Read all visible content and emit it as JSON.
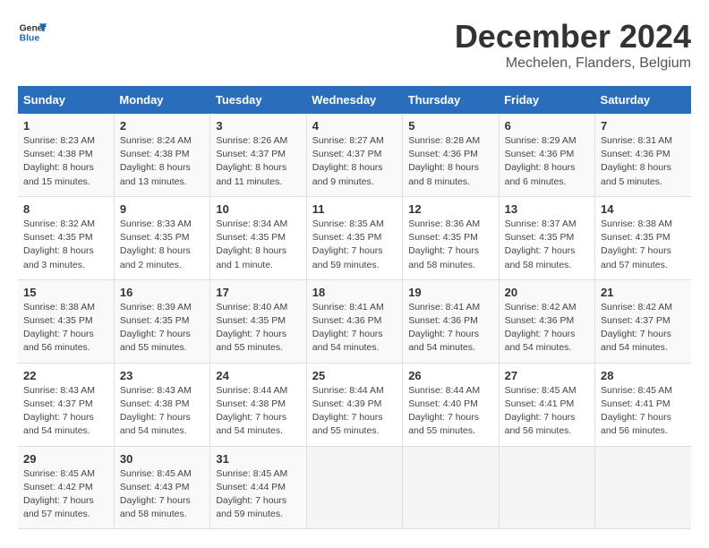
{
  "header": {
    "logo_line1": "General",
    "logo_line2": "Blue",
    "month_year": "December 2024",
    "location": "Mechelen, Flanders, Belgium"
  },
  "days_of_week": [
    "Sunday",
    "Monday",
    "Tuesday",
    "Wednesday",
    "Thursday",
    "Friday",
    "Saturday"
  ],
  "weeks": [
    [
      {
        "day": "1",
        "info": "Sunrise: 8:23 AM\nSunset: 4:38 PM\nDaylight: 8 hours\nand 15 minutes."
      },
      {
        "day": "2",
        "info": "Sunrise: 8:24 AM\nSunset: 4:38 PM\nDaylight: 8 hours\nand 13 minutes."
      },
      {
        "day": "3",
        "info": "Sunrise: 8:26 AM\nSunset: 4:37 PM\nDaylight: 8 hours\nand 11 minutes."
      },
      {
        "day": "4",
        "info": "Sunrise: 8:27 AM\nSunset: 4:37 PM\nDaylight: 8 hours\nand 9 minutes."
      },
      {
        "day": "5",
        "info": "Sunrise: 8:28 AM\nSunset: 4:36 PM\nDaylight: 8 hours\nand 8 minutes."
      },
      {
        "day": "6",
        "info": "Sunrise: 8:29 AM\nSunset: 4:36 PM\nDaylight: 8 hours\nand 6 minutes."
      },
      {
        "day": "7",
        "info": "Sunrise: 8:31 AM\nSunset: 4:36 PM\nDaylight: 8 hours\nand 5 minutes."
      }
    ],
    [
      {
        "day": "8",
        "info": "Sunrise: 8:32 AM\nSunset: 4:35 PM\nDaylight: 8 hours\nand 3 minutes."
      },
      {
        "day": "9",
        "info": "Sunrise: 8:33 AM\nSunset: 4:35 PM\nDaylight: 8 hours\nand 2 minutes."
      },
      {
        "day": "10",
        "info": "Sunrise: 8:34 AM\nSunset: 4:35 PM\nDaylight: 8 hours\nand 1 minute."
      },
      {
        "day": "11",
        "info": "Sunrise: 8:35 AM\nSunset: 4:35 PM\nDaylight: 7 hours\nand 59 minutes."
      },
      {
        "day": "12",
        "info": "Sunrise: 8:36 AM\nSunset: 4:35 PM\nDaylight: 7 hours\nand 58 minutes."
      },
      {
        "day": "13",
        "info": "Sunrise: 8:37 AM\nSunset: 4:35 PM\nDaylight: 7 hours\nand 58 minutes."
      },
      {
        "day": "14",
        "info": "Sunrise: 8:38 AM\nSunset: 4:35 PM\nDaylight: 7 hours\nand 57 minutes."
      }
    ],
    [
      {
        "day": "15",
        "info": "Sunrise: 8:38 AM\nSunset: 4:35 PM\nDaylight: 7 hours\nand 56 minutes."
      },
      {
        "day": "16",
        "info": "Sunrise: 8:39 AM\nSunset: 4:35 PM\nDaylight: 7 hours\nand 55 minutes."
      },
      {
        "day": "17",
        "info": "Sunrise: 8:40 AM\nSunset: 4:35 PM\nDaylight: 7 hours\nand 55 minutes."
      },
      {
        "day": "18",
        "info": "Sunrise: 8:41 AM\nSunset: 4:36 PM\nDaylight: 7 hours\nand 54 minutes."
      },
      {
        "day": "19",
        "info": "Sunrise: 8:41 AM\nSunset: 4:36 PM\nDaylight: 7 hours\nand 54 minutes."
      },
      {
        "day": "20",
        "info": "Sunrise: 8:42 AM\nSunset: 4:36 PM\nDaylight: 7 hours\nand 54 minutes."
      },
      {
        "day": "21",
        "info": "Sunrise: 8:42 AM\nSunset: 4:37 PM\nDaylight: 7 hours\nand 54 minutes."
      }
    ],
    [
      {
        "day": "22",
        "info": "Sunrise: 8:43 AM\nSunset: 4:37 PM\nDaylight: 7 hours\nand 54 minutes."
      },
      {
        "day": "23",
        "info": "Sunrise: 8:43 AM\nSunset: 4:38 PM\nDaylight: 7 hours\nand 54 minutes."
      },
      {
        "day": "24",
        "info": "Sunrise: 8:44 AM\nSunset: 4:38 PM\nDaylight: 7 hours\nand 54 minutes."
      },
      {
        "day": "25",
        "info": "Sunrise: 8:44 AM\nSunset: 4:39 PM\nDaylight: 7 hours\nand 55 minutes."
      },
      {
        "day": "26",
        "info": "Sunrise: 8:44 AM\nSunset: 4:40 PM\nDaylight: 7 hours\nand 55 minutes."
      },
      {
        "day": "27",
        "info": "Sunrise: 8:45 AM\nSunset: 4:41 PM\nDaylight: 7 hours\nand 56 minutes."
      },
      {
        "day": "28",
        "info": "Sunrise: 8:45 AM\nSunset: 4:41 PM\nDaylight: 7 hours\nand 56 minutes."
      }
    ],
    [
      {
        "day": "29",
        "info": "Sunrise: 8:45 AM\nSunset: 4:42 PM\nDaylight: 7 hours\nand 57 minutes."
      },
      {
        "day": "30",
        "info": "Sunrise: 8:45 AM\nSunset: 4:43 PM\nDaylight: 7 hours\nand 58 minutes."
      },
      {
        "day": "31",
        "info": "Sunrise: 8:45 AM\nSunset: 4:44 PM\nDaylight: 7 hours\nand 59 minutes."
      },
      null,
      null,
      null,
      null
    ]
  ]
}
